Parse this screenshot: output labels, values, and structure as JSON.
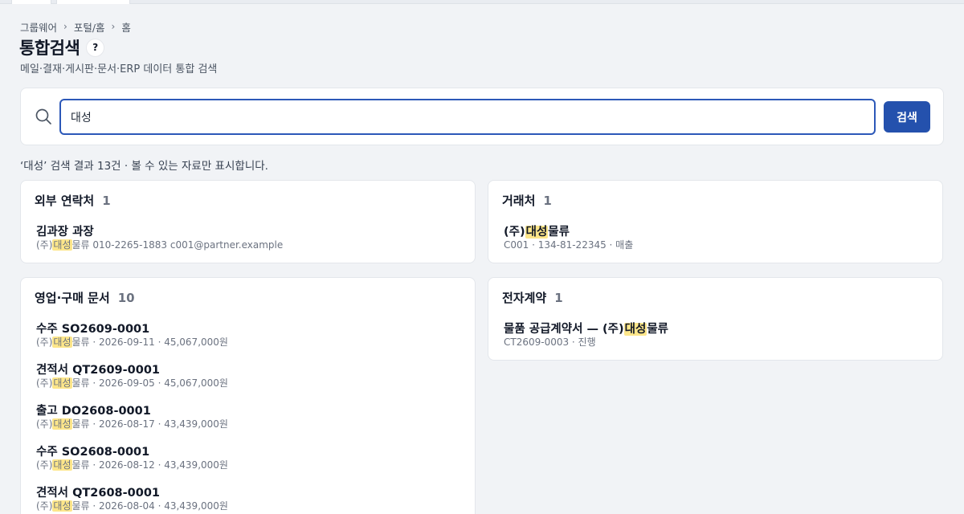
{
  "breadcrumb": [
    "그룹웨어",
    "포털/홈",
    "홈"
  ],
  "page": {
    "title": "통합검색",
    "help_label": "?",
    "subtitle": "메일·결재·게시판·문서·ERP 데이터 통합 검색"
  },
  "search": {
    "value": "대성",
    "button_label": "검색"
  },
  "summary": "‘대성’ 검색 결과 13건 · 볼 수 있는 자료만 표시합니다.",
  "colors": {
    "accent": "#2451ad",
    "highlight": "#fde68a",
    "background": "#f1f3f6"
  },
  "sections": {
    "contacts": {
      "title": "외부 연락처",
      "count": "1",
      "items": [
        {
          "title": "김과장 과장",
          "sub_pre": "(주)",
          "sub_mark": "대성",
          "sub_post": "물류 010-2265-1883 c001@partner.example"
        }
      ]
    },
    "clients": {
      "title": "거래처",
      "count": "1",
      "items": [
        {
          "title_pre": "(주)",
          "title_mark": "대성",
          "title_post": "물류",
          "sub": "C001 · 134-81-22345 · 매출"
        }
      ]
    },
    "documents": {
      "title": "영업·구매 문서",
      "count": "10",
      "items": [
        {
          "title": "수주 SO2609-0001",
          "sub_pre": "(주)",
          "sub_mark": "대성",
          "sub_post": "물류 · 2026-09-11 · 45,067,000원"
        },
        {
          "title": "견적서 QT2609-0001",
          "sub_pre": "(주)",
          "sub_mark": "대성",
          "sub_post": "물류 · 2026-09-05 · 45,067,000원"
        },
        {
          "title": "출고 DO2608-0001",
          "sub_pre": "(주)",
          "sub_mark": "대성",
          "sub_post": "물류 · 2026-08-17 · 43,439,000원"
        },
        {
          "title": "수주 SO2608-0001",
          "sub_pre": "(주)",
          "sub_mark": "대성",
          "sub_post": "물류 · 2026-08-12 · 43,439,000원"
        },
        {
          "title": "견적서 QT2608-0001",
          "sub_pre": "(주)",
          "sub_mark": "대성",
          "sub_post": "물류 · 2026-08-04 · 43,439,000원"
        }
      ]
    },
    "contracts": {
      "title": "전자계약",
      "count": "1",
      "items": [
        {
          "title_pre": "물품 공급계약서 — (주)",
          "title_mark": "대성",
          "title_post": "물류",
          "sub": "CT2609-0003 · 진행"
        }
      ]
    }
  }
}
